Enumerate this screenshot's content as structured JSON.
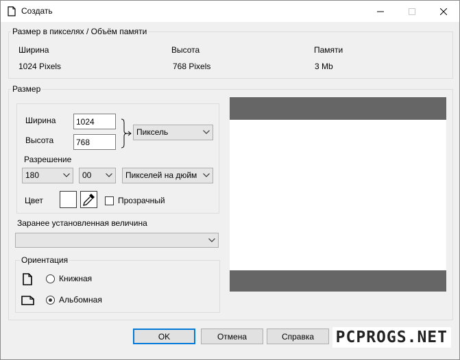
{
  "window": {
    "title": "Создать"
  },
  "memory_group": {
    "legend": "Размер в пикселях / Объём памяти",
    "width_label": "Ширина",
    "height_label": "Высота",
    "memory_label": "Памяти",
    "width_value": "1024 Pixels",
    "height_value": "768 Pixels",
    "memory_value": "3 Mb"
  },
  "size_group": {
    "legend": "Размер",
    "width_label": "Ширина",
    "width_value": "1024",
    "height_label": "Высота",
    "height_value": "768",
    "unit_selected": "Пиксель",
    "resolution_label": "Разрешение",
    "resolution_value": "180",
    "resolution_fraction": "00",
    "resolution_unit": "Пикселей на дюйм",
    "color_label": "Цвет",
    "transparent_label": "Прозрачный",
    "transparent_checked": false,
    "color_swatch": "#ffffff"
  },
  "preset": {
    "label": "Заранее установленная величина",
    "value": ""
  },
  "orientation": {
    "legend": "Ориентация",
    "portrait_label": "Книжная",
    "landscape_label": "Альбомная",
    "selected": "landscape"
  },
  "preview": {
    "bar_color": "#666666",
    "page_color": "#ffffff"
  },
  "buttons": {
    "ok": "OK",
    "cancel": "Отмена",
    "help": "Справка"
  },
  "watermark": "PCPROGS.NET",
  "colors": {
    "accent": "#0078d7",
    "dialog_bg": "#f0f0f0"
  }
}
